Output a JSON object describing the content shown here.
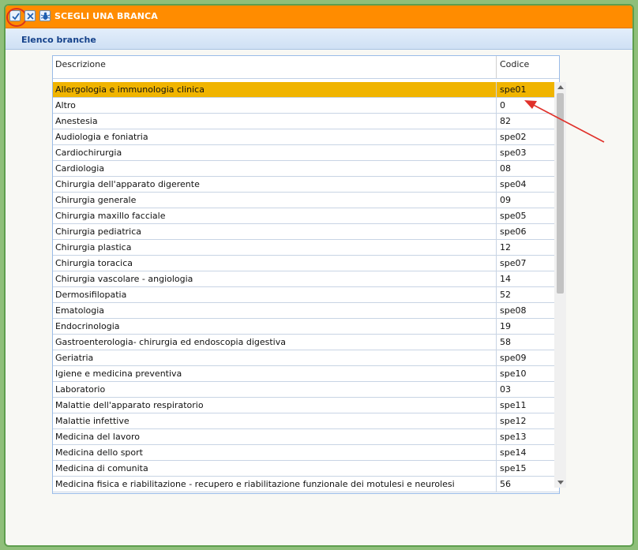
{
  "window": {
    "title": "SCEGLI UNA BRANCA",
    "subtitle": "Elenco branche"
  },
  "toolbar": {
    "confirm_icon": "check-icon",
    "cancel_icon": "close-icon",
    "bug_icon": "bug-icon"
  },
  "grid": {
    "columns": [
      "Descrizione",
      "Codice"
    ],
    "selected_index": 0,
    "rows": [
      {
        "descrizione": "Allergologia e immunologia clinica",
        "codice": "spe01"
      },
      {
        "descrizione": "Altro",
        "codice": "0"
      },
      {
        "descrizione": "Anestesia",
        "codice": "82"
      },
      {
        "descrizione": "Audiologia e foniatria",
        "codice": "spe02"
      },
      {
        "descrizione": "Cardiochirurgia",
        "codice": "spe03"
      },
      {
        "descrizione": "Cardiologia",
        "codice": "08"
      },
      {
        "descrizione": "Chirurgia dell'apparato digerente",
        "codice": "spe04"
      },
      {
        "descrizione": "Chirurgia generale",
        "codice": "09"
      },
      {
        "descrizione": "Chirurgia maxillo facciale",
        "codice": "spe05"
      },
      {
        "descrizione": "Chirurgia pediatrica",
        "codice": "spe06"
      },
      {
        "descrizione": "Chirurgia plastica",
        "codice": "12"
      },
      {
        "descrizione": "Chirurgia toracica",
        "codice": "spe07"
      },
      {
        "descrizione": "Chirurgia vascolare - angiologia",
        "codice": "14"
      },
      {
        "descrizione": "Dermosifilopatia",
        "codice": "52"
      },
      {
        "descrizione": "Ematologia",
        "codice": "spe08"
      },
      {
        "descrizione": "Endocrinologia",
        "codice": "19"
      },
      {
        "descrizione": "Gastroenterologia- chirurgia ed endoscopia digestiva",
        "codice": "58"
      },
      {
        "descrizione": "Geriatria",
        "codice": "spe09"
      },
      {
        "descrizione": "Igiene e medicina preventiva",
        "codice": "spe10"
      },
      {
        "descrizione": "Laboratorio",
        "codice": "03"
      },
      {
        "descrizione": "Malattie dell'apparato respiratorio",
        "codice": "spe11"
      },
      {
        "descrizione": "Malattie infettive",
        "codice": "spe12"
      },
      {
        "descrizione": "Medicina del lavoro",
        "codice": "spe13"
      },
      {
        "descrizione": "Medicina dello sport",
        "codice": "spe14"
      },
      {
        "descrizione": "Medicina di comunita",
        "codice": "spe15"
      },
      {
        "descrizione": "Medicina fisica e riabilitazione - recupero e riabilitazione funzionale dei motulesi e neurolesi",
        "codice": "56"
      }
    ]
  },
  "colors": {
    "titlebar": "#ff8c00",
    "selected_row": "#f0b400",
    "annotation": "#e0312a"
  }
}
